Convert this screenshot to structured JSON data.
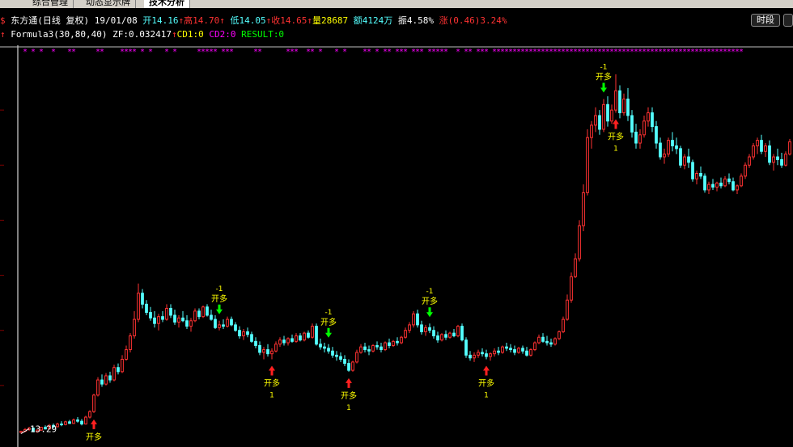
{
  "tabs": [
    "综合管理",
    "动态显示牌",
    "技术分析"
  ],
  "header": {
    "stock_icon": "$",
    "name": "东方通(日线 复权)",
    "date": "19/01/08",
    "open_label": "开",
    "open": "14.16",
    "high_label": "高",
    "high": "14.70",
    "low_label": "低",
    "low": "14.05",
    "close_label": "收",
    "close": "14.65",
    "volume_label": "量",
    "volume": "28687",
    "amount_label": "额",
    "amount": "4124万",
    "amplitude_label": "振",
    "amplitude": "4.58%",
    "change_label": "涨",
    "change": "(0.46)",
    "change_pct": "3.24%",
    "button": "时段"
  },
  "formula": {
    "name": "Formula3(30,80,40)",
    "zf": "ZF:0.032417",
    "cd1": "CD1:0",
    "cd2": "CD2:0",
    "result": "RESULT:0"
  },
  "colors": {
    "up": "#ff3232",
    "down": "#54ffff",
    "buy": "#ff2020",
    "sell": "#00ff00",
    "marker": "#ff00ff",
    "label": "#ffff00",
    "grid": "#800000"
  },
  "chart_data": {
    "type": "candlestick",
    "ylim": [
      13.0,
      27.0
    ],
    "min_label": "13.29",
    "candles": [
      [
        13.29,
        13.35,
        13.25,
        13.34
      ],
      [
        13.34,
        13.45,
        13.3,
        13.4
      ],
      [
        13.4,
        13.5,
        13.35,
        13.45
      ],
      [
        13.45,
        13.48,
        13.3,
        13.32
      ],
      [
        13.32,
        13.4,
        13.28,
        13.38
      ],
      [
        13.38,
        13.5,
        13.35,
        13.48
      ],
      [
        13.48,
        13.55,
        13.4,
        13.42
      ],
      [
        13.42,
        13.6,
        13.4,
        13.55
      ],
      [
        13.55,
        13.62,
        13.45,
        13.5
      ],
      [
        13.5,
        13.65,
        13.48,
        13.6
      ],
      [
        13.6,
        13.7,
        13.52,
        13.58
      ],
      [
        13.58,
        13.72,
        13.55,
        13.68
      ],
      [
        13.68,
        13.75,
        13.6,
        13.62
      ],
      [
        13.62,
        13.8,
        13.6,
        13.75
      ],
      [
        13.75,
        13.85,
        13.65,
        13.7
      ],
      [
        13.7,
        13.78,
        13.55,
        13.6
      ],
      [
        13.6,
        13.9,
        13.58,
        13.85
      ],
      [
        13.85,
        14.1,
        13.8,
        14.05
      ],
      [
        14.05,
        14.7,
        14.0,
        14.65
      ],
      [
        14.65,
        15.3,
        14.6,
        15.2
      ],
      [
        15.2,
        15.4,
        14.95,
        15.05
      ],
      [
        15.05,
        15.45,
        15.0,
        15.35
      ],
      [
        15.35,
        15.5,
        15.1,
        15.2
      ],
      [
        15.2,
        15.75,
        15.15,
        15.65
      ],
      [
        15.65,
        15.8,
        15.4,
        15.5
      ],
      [
        15.5,
        16.1,
        15.45,
        15.95
      ],
      [
        15.95,
        16.45,
        15.9,
        16.3
      ],
      [
        16.3,
        16.9,
        16.2,
        16.8
      ],
      [
        16.8,
        17.7,
        16.7,
        17.4
      ],
      [
        17.4,
        18.7,
        17.3,
        18.35
      ],
      [
        18.35,
        18.5,
        17.8,
        17.95
      ],
      [
        17.95,
        18.1,
        17.55,
        17.65
      ],
      [
        17.65,
        17.85,
        17.35,
        17.45
      ],
      [
        17.45,
        17.7,
        17.1,
        17.25
      ],
      [
        17.25,
        17.6,
        17.0,
        17.5
      ],
      [
        17.5,
        17.7,
        17.3,
        17.4
      ],
      [
        17.4,
        17.95,
        17.35,
        17.8
      ],
      [
        17.8,
        17.95,
        17.45,
        17.55
      ],
      [
        17.55,
        17.75,
        17.2,
        17.3
      ],
      [
        17.3,
        17.55,
        17.1,
        17.45
      ],
      [
        17.45,
        17.7,
        17.3,
        17.35
      ],
      [
        17.35,
        17.55,
        17.05,
        17.15
      ],
      [
        17.15,
        17.45,
        16.95,
        17.35
      ],
      [
        17.35,
        17.8,
        17.3,
        17.7
      ],
      [
        17.7,
        17.8,
        17.4,
        17.5
      ],
      [
        17.5,
        17.9,
        17.45,
        17.85
      ],
      [
        17.85,
        17.95,
        17.5,
        17.55
      ],
      [
        17.55,
        17.75,
        17.35,
        17.4
      ],
      [
        17.4,
        17.55,
        17.05,
        17.1
      ],
      [
        17.1,
        17.35,
        17.0,
        17.2
      ],
      [
        17.2,
        17.4,
        17.05,
        17.15
      ],
      [
        17.15,
        17.5,
        17.1,
        17.4
      ],
      [
        17.4,
        17.5,
        17.15,
        17.2
      ],
      [
        17.2,
        17.3,
        16.95,
        17.0
      ],
      [
        17.0,
        17.15,
        16.7,
        16.8
      ],
      [
        16.8,
        17.05,
        16.65,
        16.95
      ],
      [
        16.95,
        17.1,
        16.75,
        16.85
      ],
      [
        16.85,
        16.95,
        16.55,
        16.6
      ],
      [
        16.6,
        16.75,
        16.35,
        16.45
      ],
      [
        16.45,
        16.6,
        16.1,
        16.2
      ],
      [
        16.2,
        16.4,
        15.95,
        16.3
      ],
      [
        16.3,
        16.5,
        16.05,
        16.15
      ],
      [
        16.15,
        16.35,
        15.95,
        16.25
      ],
      [
        16.25,
        16.6,
        16.2,
        16.5
      ],
      [
        16.5,
        16.75,
        16.4,
        16.65
      ],
      [
        16.65,
        16.8,
        16.45,
        16.55
      ],
      [
        16.55,
        16.75,
        16.45,
        16.7
      ],
      [
        16.7,
        16.85,
        16.55,
        16.6
      ],
      [
        16.6,
        16.9,
        16.55,
        16.8
      ],
      [
        16.8,
        16.9,
        16.6,
        16.65
      ],
      [
        16.65,
        16.95,
        16.6,
        16.9
      ],
      [
        16.9,
        17.0,
        16.7,
        16.75
      ],
      [
        16.75,
        17.25,
        16.7,
        17.15
      ],
      [
        17.15,
        17.25,
        16.45,
        16.5
      ],
      [
        16.5,
        16.7,
        16.3,
        16.4
      ],
      [
        16.4,
        16.55,
        16.2,
        16.35
      ],
      [
        16.35,
        16.5,
        16.15,
        16.25
      ],
      [
        16.25,
        16.4,
        16.0,
        16.1
      ],
      [
        16.1,
        16.25,
        15.9,
        16.05
      ],
      [
        16.05,
        16.2,
        15.85,
        15.95
      ],
      [
        15.95,
        16.1,
        15.7,
        15.8
      ],
      [
        15.8,
        15.95,
        15.5,
        15.55
      ],
      [
        15.55,
        15.9,
        15.5,
        15.85
      ],
      [
        15.85,
        16.3,
        15.8,
        16.2
      ],
      [
        16.2,
        16.5,
        16.15,
        16.4
      ],
      [
        16.4,
        16.55,
        16.2,
        16.3
      ],
      [
        16.3,
        16.45,
        16.1,
        16.25
      ],
      [
        16.25,
        16.5,
        16.2,
        16.45
      ],
      [
        16.45,
        16.6,
        16.3,
        16.4
      ],
      [
        16.4,
        16.55,
        16.2,
        16.3
      ],
      [
        16.3,
        16.6,
        16.25,
        16.55
      ],
      [
        16.55,
        16.7,
        16.35,
        16.45
      ],
      [
        16.45,
        16.65,
        16.4,
        16.6
      ],
      [
        16.6,
        16.75,
        16.45,
        16.55
      ],
      [
        16.55,
        16.8,
        16.5,
        16.75
      ],
      [
        16.75,
        17.1,
        16.7,
        17.0
      ],
      [
        17.0,
        17.3,
        16.9,
        17.2
      ],
      [
        17.2,
        17.7,
        17.1,
        17.6
      ],
      [
        17.6,
        17.75,
        17.1,
        17.2
      ],
      [
        17.2,
        17.35,
        16.85,
        16.95
      ],
      [
        16.95,
        17.2,
        16.8,
        17.1
      ],
      [
        17.1,
        17.25,
        16.9,
        17.0
      ],
      [
        17.0,
        17.15,
        16.7,
        16.8
      ],
      [
        16.8,
        16.95,
        16.55,
        16.65
      ],
      [
        16.65,
        16.9,
        16.6,
        16.85
      ],
      [
        16.85,
        17.0,
        16.65,
        16.75
      ],
      [
        16.75,
        16.95,
        16.7,
        16.9
      ],
      [
        16.9,
        17.05,
        16.75,
        16.8
      ],
      [
        16.8,
        17.2,
        16.75,
        17.15
      ],
      [
        17.15,
        17.25,
        16.6,
        16.65
      ],
      [
        16.65,
        16.75,
        16.0,
        16.1
      ],
      [
        16.1,
        16.25,
        15.9,
        16.0
      ],
      [
        16.0,
        16.2,
        15.85,
        16.1
      ],
      [
        16.1,
        16.3,
        16.0,
        16.2
      ],
      [
        16.2,
        16.35,
        16.05,
        16.15
      ],
      [
        16.15,
        16.3,
        15.95,
        16.05
      ],
      [
        16.05,
        16.2,
        15.9,
        16.15
      ],
      [
        16.15,
        16.35,
        16.05,
        16.25
      ],
      [
        16.25,
        16.4,
        16.1,
        16.2
      ],
      [
        16.2,
        16.45,
        16.15,
        16.4
      ],
      [
        16.4,
        16.55,
        16.25,
        16.35
      ],
      [
        16.35,
        16.5,
        16.2,
        16.3
      ],
      [
        16.3,
        16.45,
        16.1,
        16.2
      ],
      [
        16.2,
        16.4,
        16.15,
        16.35
      ],
      [
        16.35,
        16.45,
        16.15,
        16.25
      ],
      [
        16.25,
        16.4,
        16.05,
        16.1
      ],
      [
        16.1,
        16.35,
        16.05,
        16.3
      ],
      [
        16.3,
        16.6,
        16.25,
        16.55
      ],
      [
        16.55,
        16.85,
        16.5,
        16.75
      ],
      [
        16.75,
        16.9,
        16.55,
        16.6
      ],
      [
        16.6,
        16.8,
        16.45,
        16.55
      ],
      [
        16.55,
        16.7,
        16.4,
        16.5
      ],
      [
        16.5,
        16.75,
        16.45,
        16.7
      ],
      [
        16.7,
        17.0,
        16.65,
        16.95
      ],
      [
        16.95,
        17.5,
        16.9,
        17.4
      ],
      [
        17.4,
        18.3,
        17.35,
        18.1
      ],
      [
        18.1,
        19.1,
        18.0,
        18.95
      ],
      [
        18.95,
        19.8,
        18.9,
        19.6
      ],
      [
        19.6,
        21.0,
        19.5,
        20.8
      ],
      [
        20.8,
        22.3,
        20.6,
        22.0
      ],
      [
        22.0,
        24.3,
        21.9,
        24.0
      ],
      [
        24.0,
        24.6,
        23.6,
        24.45
      ],
      [
        24.45,
        25.1,
        24.2,
        24.8
      ],
      [
        24.8,
        25.0,
        24.1,
        24.3
      ],
      [
        24.3,
        25.4,
        24.2,
        25.2
      ],
      [
        25.2,
        25.5,
        24.4,
        24.6
      ],
      [
        24.6,
        25.2,
        24.5,
        25.0
      ],
      [
        25.0,
        26.3,
        24.9,
        25.7
      ],
      [
        25.7,
        25.9,
        24.7,
        24.9
      ],
      [
        24.9,
        25.6,
        24.8,
        25.4
      ],
      [
        25.4,
        25.8,
        24.6,
        24.8
      ],
      [
        24.8,
        25.0,
        24.0,
        24.2
      ],
      [
        24.2,
        24.5,
        23.6,
        23.8
      ],
      [
        23.8,
        24.3,
        23.6,
        24.1
      ],
      [
        24.1,
        24.8,
        24.0,
        24.6
      ],
      [
        24.6,
        25.1,
        24.4,
        24.9
      ],
      [
        24.9,
        25.1,
        24.2,
        24.4
      ],
      [
        24.4,
        24.6,
        23.6,
        23.8
      ],
      [
        23.8,
        24.0,
        23.2,
        23.3
      ],
      [
        23.3,
        23.6,
        23.05,
        23.4
      ],
      [
        23.4,
        24.0,
        23.3,
        23.9
      ],
      [
        23.9,
        24.2,
        23.5,
        23.7
      ],
      [
        23.7,
        24.0,
        23.4,
        23.6
      ],
      [
        23.6,
        23.7,
        22.9,
        23.0
      ],
      [
        23.0,
        23.4,
        22.85,
        23.3
      ],
      [
        23.3,
        23.6,
        22.9,
        23.1
      ],
      [
        23.1,
        23.2,
        22.4,
        22.5
      ],
      [
        22.5,
        22.8,
        22.3,
        22.7
      ],
      [
        22.7,
        22.95,
        22.5,
        22.6
      ],
      [
        22.6,
        22.7,
        22.0,
        22.1
      ],
      [
        22.1,
        22.4,
        21.95,
        22.3
      ],
      [
        22.3,
        22.5,
        22.1,
        22.2
      ],
      [
        22.2,
        22.4,
        22.05,
        22.35
      ],
      [
        22.35,
        22.55,
        22.15,
        22.25
      ],
      [
        22.25,
        22.6,
        22.2,
        22.5
      ],
      [
        22.5,
        22.7,
        22.3,
        22.4
      ],
      [
        22.4,
        22.55,
        22.05,
        22.1
      ],
      [
        22.1,
        22.3,
        21.95,
        22.25
      ],
      [
        22.25,
        22.7,
        22.2,
        22.6
      ],
      [
        22.6,
        23.1,
        22.5,
        23.0
      ],
      [
        23.0,
        23.4,
        22.9,
        23.3
      ],
      [
        23.3,
        23.8,
        23.2,
        23.7
      ],
      [
        23.7,
        24.0,
        23.4,
        23.9
      ],
      [
        23.9,
        24.1,
        23.4,
        23.5
      ],
      [
        23.5,
        23.8,
        23.3,
        23.7
      ],
      [
        23.7,
        23.9,
        23.0,
        23.1
      ],
      [
        23.1,
        23.4,
        22.8,
        23.3
      ],
      [
        23.3,
        23.6,
        23.0,
        23.2
      ],
      [
        23.2,
        23.45,
        22.9,
        23.0
      ],
      [
        23.0,
        23.5,
        22.95,
        23.4
      ],
      [
        23.4,
        23.95,
        23.35,
        23.85
      ]
    ],
    "signals": [
      {
        "type": "buy",
        "index": 18,
        "text": "开多"
      },
      {
        "type": "sell",
        "index": 49,
        "text": "开多",
        "value": "-1"
      },
      {
        "type": "buy",
        "index": 62,
        "text": "开多",
        "value": "1"
      },
      {
        "type": "sell",
        "index": 76,
        "text": "开多",
        "value": "-1"
      },
      {
        "type": "buy",
        "index": 81,
        "text": "开多",
        "value": "1"
      },
      {
        "type": "sell",
        "index": 101,
        "text": "开多",
        "value": "-1"
      },
      {
        "type": "buy",
        "index": 115,
        "text": "开多",
        "value": "1"
      },
      {
        "type": "sell",
        "index": 144,
        "text": "开多",
        "value": "-1"
      },
      {
        "type": "buy",
        "index": 147,
        "text": "开多",
        "value": "1"
      }
    ],
    "markers": [
      1,
      3,
      5,
      8,
      12,
      13,
      19,
      20,
      25,
      26,
      27,
      28,
      30,
      32,
      36,
      38,
      44,
      45,
      46,
      47,
      48,
      50,
      51,
      52,
      58,
      59,
      66,
      67,
      68,
      71,
      72,
      74,
      78,
      80,
      85,
      86,
      88,
      90,
      91,
      93,
      94,
      95,
      97,
      98,
      99,
      101,
      102,
      103,
      104,
      105,
      108,
      110,
      111,
      113,
      114,
      115,
      117,
      118,
      119,
      120,
      121,
      122,
      123,
      124,
      125,
      126,
      127,
      128,
      129,
      130,
      131,
      132,
      133,
      134,
      135,
      136,
      137,
      138,
      139,
      140,
      141,
      142,
      143,
      144,
      145,
      146,
      147,
      148,
      149,
      150,
      151,
      152,
      153,
      154,
      155,
      156,
      157,
      158,
      159,
      160,
      161,
      162,
      163,
      164,
      165,
      166,
      167,
      168,
      169,
      170,
      171,
      172,
      173,
      174,
      175,
      176,
      177,
      178
    ]
  }
}
